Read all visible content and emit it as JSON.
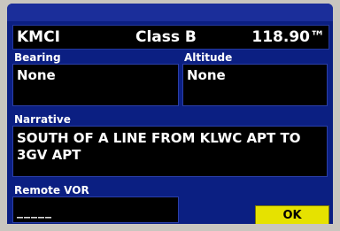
{
  "header": {
    "identifier": "KMCI",
    "airspace_class": "Class B",
    "frequency": "118.90™"
  },
  "bearing": {
    "label": "Bearing",
    "value": "None"
  },
  "altitude": {
    "label": "Altitude",
    "value": "None"
  },
  "narrative": {
    "label": "Narrative",
    "text": "SOUTH OF A LINE FROM KLWC APT TO 3GV APT"
  },
  "remote_vor": {
    "label": "Remote VOR",
    "value": "_____"
  },
  "buttons": {
    "ok_label": "OK"
  },
  "colors": {
    "background": "#0b1f82",
    "field_background": "#000000",
    "ok_button": "#e6e200",
    "text": "#ffffff"
  }
}
